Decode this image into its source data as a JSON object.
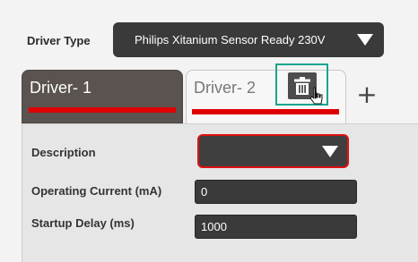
{
  "driver_type": {
    "label": "Driver Type",
    "selected": "Philips Xitanium Sensor Ready 230V"
  },
  "tabs": [
    {
      "label": "Driver- 1",
      "underline_color": "#e00000",
      "active": false
    },
    {
      "label": "Driver- 2",
      "underline_color": "#e00000",
      "active": true
    }
  ],
  "tab_actions": {
    "add_label": "+",
    "delete_icon": "trash-icon"
  },
  "form": {
    "description": {
      "label": "Description",
      "value": ""
    },
    "operating_current": {
      "label": "Operating Current (mA)",
      "value": "0"
    },
    "startup_delay": {
      "label": "Startup Delay (ms)",
      "value": "1000"
    }
  },
  "colors": {
    "accent_red": "#e00000",
    "highlight_teal": "#17a58f",
    "dark_control": "#3a3a3a"
  }
}
